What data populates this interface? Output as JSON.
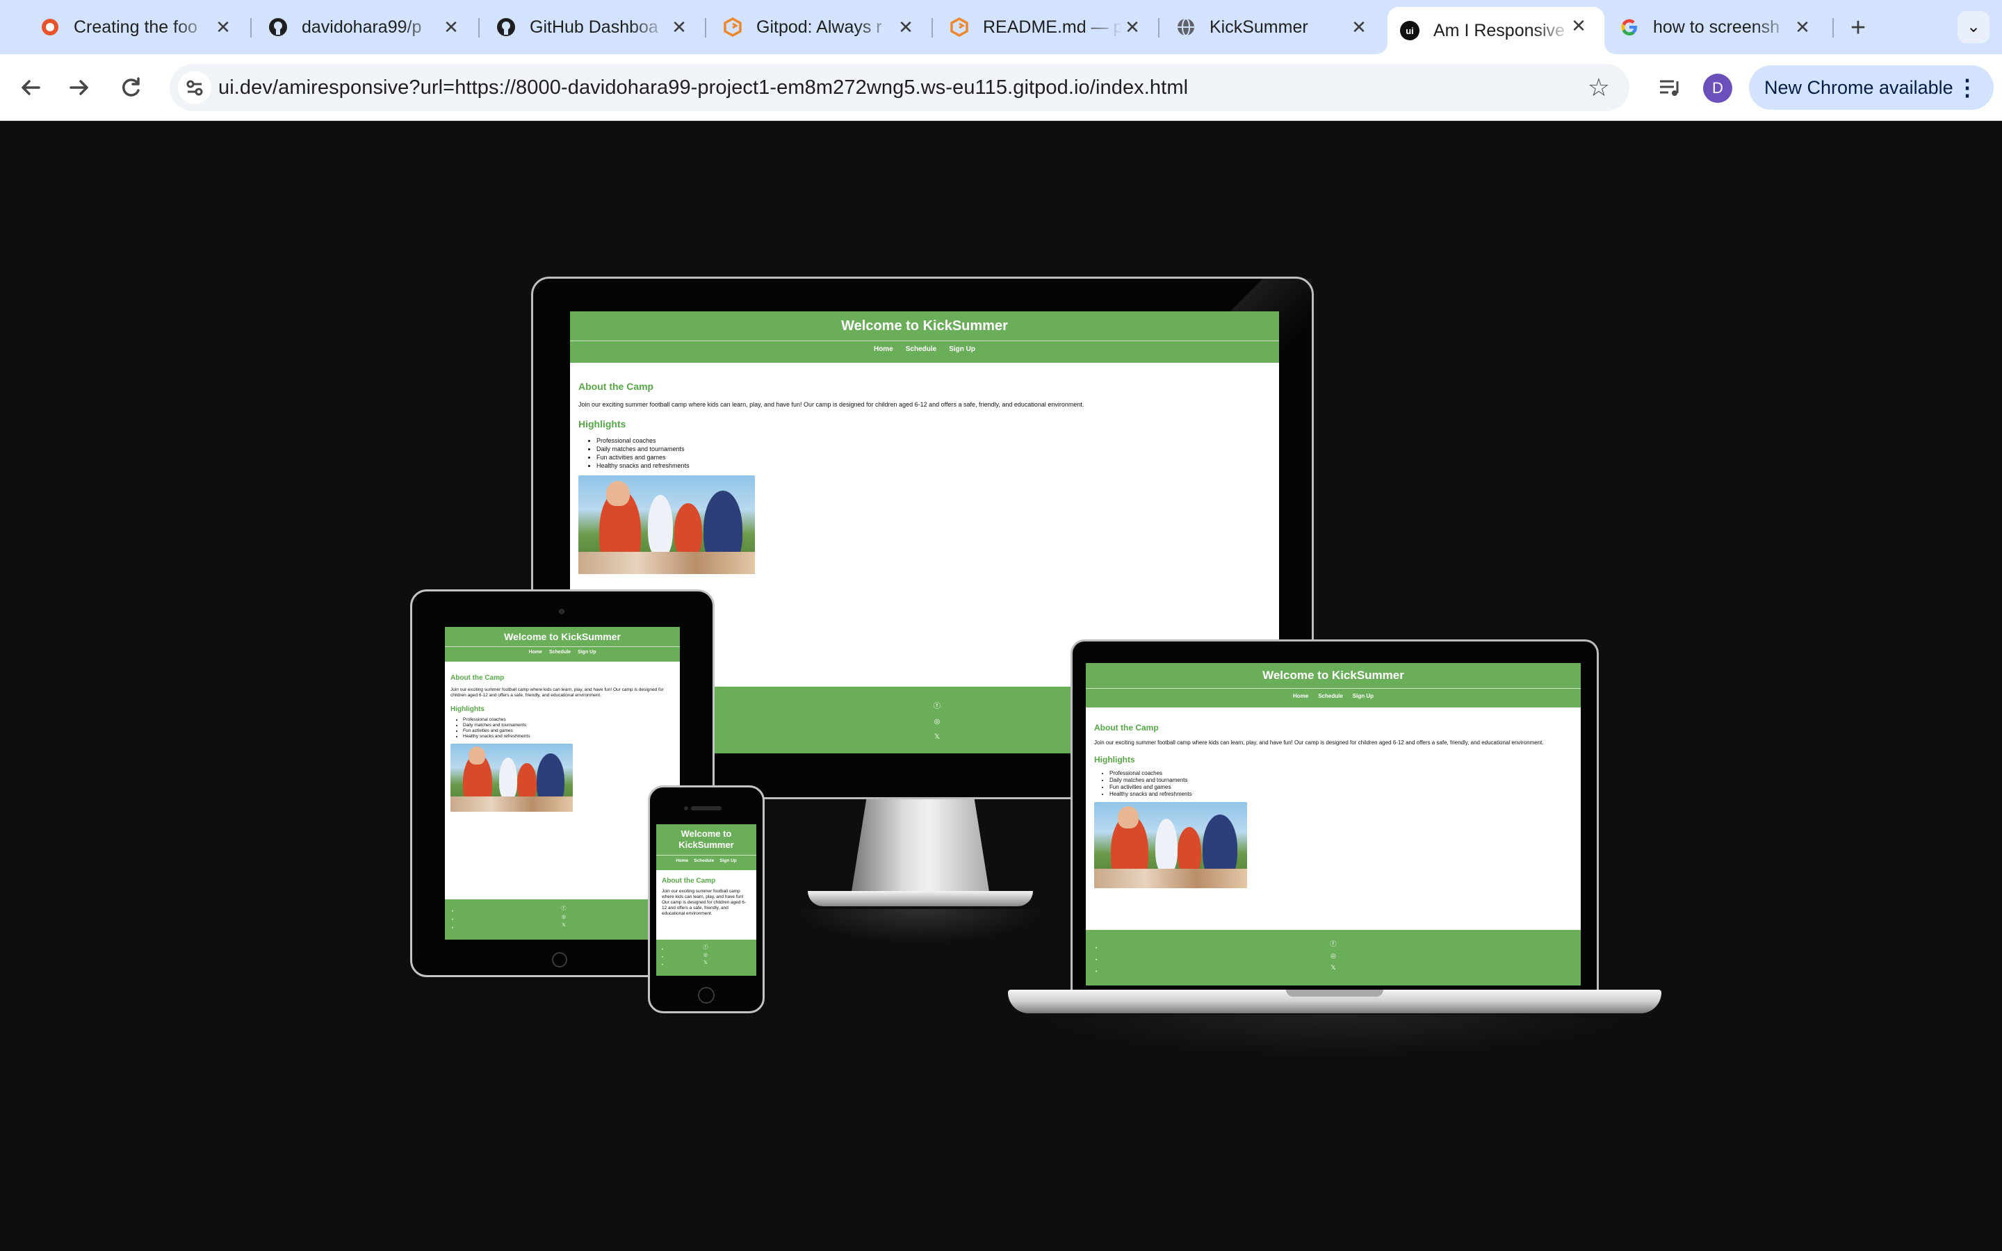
{
  "browser": {
    "tabs": [
      {
        "title": "Creating the foo",
        "icon": "red-circle-icon",
        "active": false
      },
      {
        "title": "davidohara99/p",
        "icon": "github-icon",
        "active": false
      },
      {
        "title": "GitHub Dashboa",
        "icon": "github-icon",
        "active": false
      },
      {
        "title": "Gitpod: Always r",
        "icon": "gitpod-icon",
        "active": false
      },
      {
        "title": "README.md — p",
        "icon": "gitpod-icon",
        "active": false
      },
      {
        "title": "KickSummer",
        "icon": "globe-icon",
        "active": false
      },
      {
        "title": "Am I Responsive",
        "icon": "ui-dev-icon",
        "active": true
      },
      {
        "title": "how to screensh",
        "icon": "google-icon",
        "active": false
      }
    ],
    "url": "ui.dev/amiresponsive?url=https://8000-davidohara99-project1-em8m272wng5.ws-eu115.gitpod.io/index.html",
    "update_label": "New Chrome available",
    "avatar_letter": "D",
    "colors": {
      "tabstrip": "#d3e3fd",
      "toolbar": "#ffffff",
      "page_bg": "#0f0e0e"
    }
  },
  "site": {
    "title": "Welcome to KickSummer",
    "nav": [
      "Home",
      "Schedule",
      "Sign Up"
    ],
    "about_heading": "About the Camp",
    "about_text": "Join our exciting summer football camp where kids can learn, play, and have fun! Our camp is designed for children aged 6-12 and offers a safe, friendly, and educational environment.",
    "highlights_heading": "Highlights",
    "highlights": [
      "Professional coaches",
      "Daily matches and tournaments",
      "Fun activities and games",
      "Healthy snacks and refreshments"
    ],
    "social_icons": [
      "facebook-icon",
      "instagram-icon",
      "x-icon"
    ],
    "brand_color": "#6aae5a",
    "heading_color": "#55a845"
  }
}
